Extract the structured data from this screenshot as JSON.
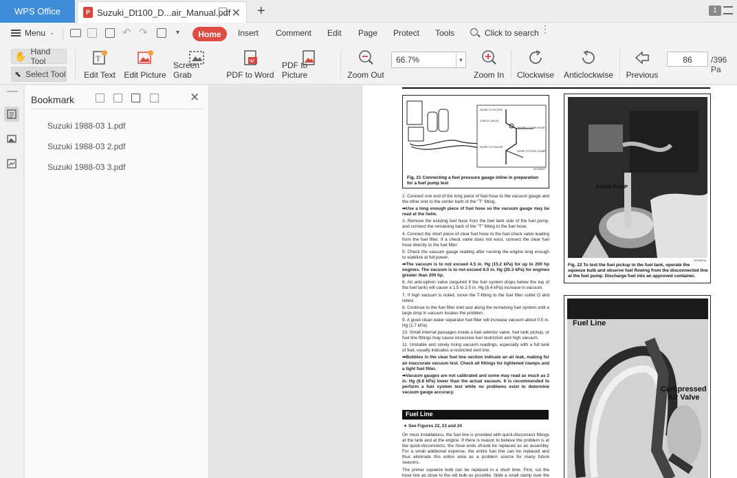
{
  "app": {
    "name": "WPS Office",
    "doc_tab_title": "Suzuki_Dt100_D...air_Manual.pdf",
    "tab_badge": "P",
    "window_count": "1"
  },
  "menubar": {
    "menu_label": "Menu",
    "tabs": [
      "Home",
      "Insert",
      "Comment",
      "Edit",
      "Page",
      "Protect",
      "Tools"
    ],
    "search_label": "Click to search"
  },
  "toolbar": {
    "hand_tool": "Hand Tool",
    "select_tool": "Select Tool",
    "edit_text": "Edit Text",
    "edit_picture": "Edit Picture",
    "screen_grab": "Screen Grab",
    "pdf_to_word": "PDF to Word",
    "pdf_to_picture": "PDF to Picture",
    "zoom_out": "Zoom Out",
    "zoom_value": "66.7%",
    "zoom_in": "Zoom In",
    "clockwise": "Clockwise",
    "anticlockwise": "Anticlockwise",
    "previous": "Previous",
    "current_page": "86",
    "total_pages": "/396 Pa"
  },
  "bookmark": {
    "title": "Bookmark",
    "items": [
      "Suzuki 1988-03 1.pdf",
      "Suzuki 1988-03 2.pdf",
      "Suzuki 1988-03 3.pdf"
    ]
  },
  "document": {
    "fig21": {
      "caption": "Fig. 21 Connecting a fuel pressure gauge inline in preparation for a fuel pump test",
      "code": "04704527",
      "labels": [
        "HOSE TO FILTER",
        "CHECK VALVE",
        "SHORT CLEAR HOSE",
        "HOSE TO GAUGE",
        "HOSE TO FUEL PUMP"
      ]
    },
    "fig22": {
      "caption": "Fig. 22 To test the fuel pickup in the fuel tank, operate the squeeze bulb and observe fuel flowing from the disconnected line at the fuel pump. Discharge fuel into an approved container.",
      "label": "FROM PUMP",
      "code": "04704P16"
    },
    "fig23": {
      "label_fuel_line": "Fuel Line",
      "label_air_valve_1": "Compressed",
      "label_air_valve_2": "Air Valve"
    },
    "paragraphs": [
      {
        "bold": false,
        "text": "2. Connect one end of the long piece of fuel hose to the vacuum gauge and the other end to the center barb of the \"T\" fitting."
      },
      {
        "bold": true,
        "text": "➡Use a long enough piece of fuel hose so the vacuum gauge may be read at the helm."
      },
      {
        "bold": false,
        "text": "3. Remove the existing fuel hose from the fuel tank side of the fuel pump, and connect the remaining barb of the \"T\" fitting to the fuel hose."
      },
      {
        "bold": false,
        "text": "4. Connect the short piece of clear fuel hose to the fuel check valve leading from the fuel filter. If a check valve does not exist, connect the clear fuel hose directly to the fuel filter."
      },
      {
        "bold": false,
        "text": "5. Check the vacuum gauge reading after running the engine long enough to stabilize at full power."
      },
      {
        "bold": true,
        "text": "➡The vacuum is to not exceed 4.5 in. Hg (15.2 kPa) for up to 200 hp engines. The vacuum is to not exceed 6.0 in. Hg (20.3 kPa) for engines greater than 200 hp."
      },
      {
        "bold": false,
        "text": "6. An anti-siphon valve (required if the fuel system drops below the top of the fuel tank) will cause a 1.5 to 2.5 in. Hg (8.4 kPa) increase in vacuum."
      },
      {
        "bold": false,
        "text": "7. If high vacuum is noted, move the T-fitting to the fuel filter outlet O and retest."
      },
      {
        "bold": false,
        "text": "8. Continue to the fuel filter inlet and along the remaining fuel system until a large drop in vacuum locates the problem."
      },
      {
        "bold": false,
        "text": "9. A good clean water separator fuel filter will increase vacuum about 0.5 in. Hg (1.7 kPa)."
      },
      {
        "bold": false,
        "text": "10. Small internal passages inside a fuel selector valve, fuel tank pickup, or fuel line fittings may cause excessive fuel restriction and high vacuum."
      },
      {
        "bold": false,
        "text": "11. Unstable and slowly rising vacuum readings, especially with a full tank of fuel, usually indicates a restricted vent line."
      },
      {
        "bold": true,
        "text": "➡Bubbles in the clear fuel line section indicate an air leak, making for an inaccurate vacuum test. Check all fittings for tightened clamps and a tight fuel filter."
      },
      {
        "bold": true,
        "text": "➡Vacuum gauges are not calibrated and some may read as much as 2 in. Hg (6.8 kPa) lower than the actual vacuum. It is recommended to perform a fuel system test while no problems exist to determine vacuum gauge accuracy."
      }
    ],
    "section_title": "Fuel Line",
    "see_figures": "➧ See Figures 22, 23 and 24",
    "paragraphs2": [
      {
        "bold": false,
        "text": "On most installations, the fuel line is provided with quick-disconnect fittings at the tank and at the engine. If there is reason to believe the problem is at the quick-disconnects, the hose ends should be replaced as an assembly. For a small additional expense, the entire fuel line can be replaced and thus eliminate this entire area as a problem source for many future seasons."
      },
      {
        "bold": false,
        "text": "The primer squeeze bulb can be replaced in a short time. First, cut the hose line as close to the old bulb as possible. Slide a small clamp over the end of the fuel line from the tank. Next, install the small end of the check valve assembly"
      }
    ]
  }
}
